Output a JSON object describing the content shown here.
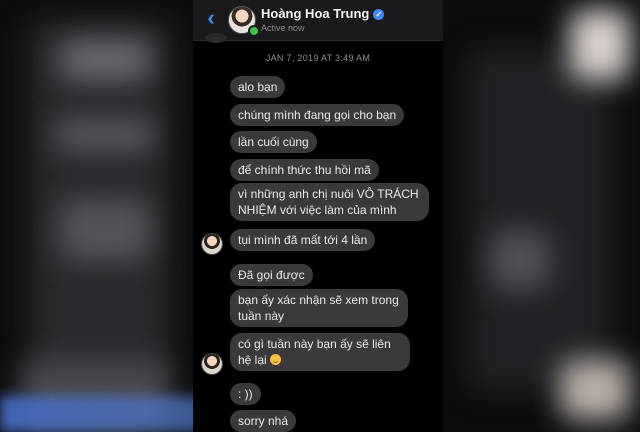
{
  "header": {
    "name": "Hoàng Hoa Trung",
    "status": "Active now",
    "back_icon": "chevron-left-icon",
    "verified_icon": "verified-badge-icon"
  },
  "timestamp": "JAN 7, 2019 AT 3:49 AM",
  "messages": [
    {
      "text": "alo  bạn"
    },
    {
      "text": "chúng mình đang gọi cho bạn"
    },
    {
      "text": "lần cuối cùng"
    },
    {
      "text": "để chính thức thu hồi mã"
    },
    {
      "text": "vì những anh chị nuôi VÔ TRÁCH NHIỆM với việc làm của mình"
    },
    {
      "text": "tụi mình đã mất tới 4 lần"
    },
    {
      "text": "Đã gọi được"
    },
    {
      "text": "bạn ấy xác nhận sẽ xem trong tuần này"
    },
    {
      "text": "có gì tuần này bạn ấy sẽ liên hệ lại"
    },
    {
      "text": ": ))"
    },
    {
      "text": "sorry nhá"
    }
  ],
  "colors": {
    "accent": "#3a8bff",
    "bubble": "#3a3a3c",
    "background": "#000000",
    "online": "#33c94a"
  }
}
